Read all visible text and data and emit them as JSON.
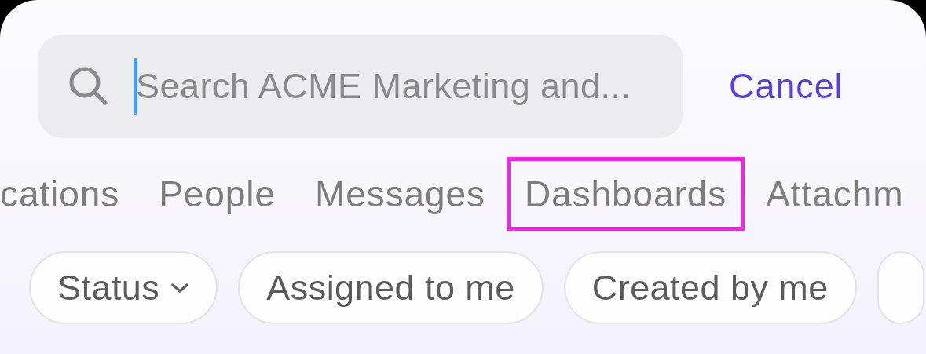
{
  "search": {
    "placeholder": "Search ACME Marketing and..."
  },
  "cancel_button": "Cancel",
  "tabs": [
    {
      "label": "cations",
      "highlighted": false
    },
    {
      "label": "People",
      "highlighted": false
    },
    {
      "label": "Messages",
      "highlighted": false
    },
    {
      "label": "Dashboards",
      "highlighted": true
    },
    {
      "label": "Attachm",
      "highlighted": false
    }
  ],
  "filters": [
    {
      "label": "Status",
      "kind": "dropdown"
    },
    {
      "label": "Assigned to me",
      "kind": "toggle"
    },
    {
      "label": "Created by me",
      "kind": "toggle"
    }
  ]
}
